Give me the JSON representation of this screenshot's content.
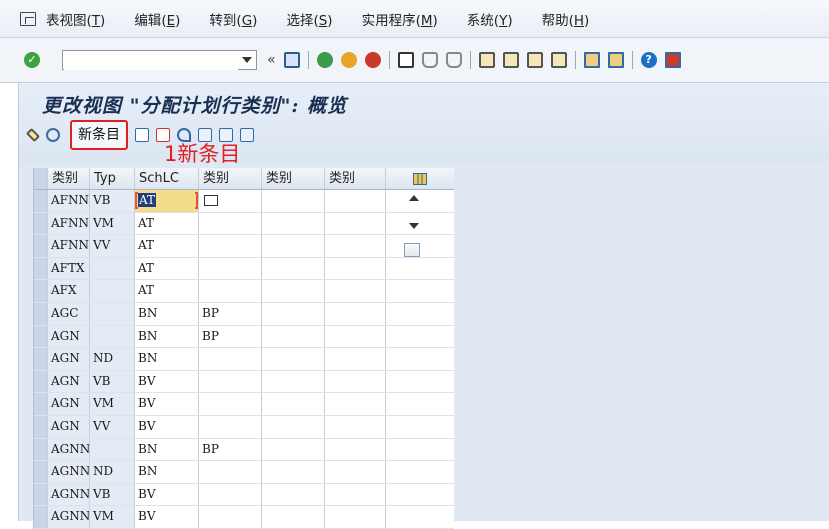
{
  "menu": {
    "items": [
      {
        "label": "表视图",
        "key": "T"
      },
      {
        "label": "编辑",
        "key": "E"
      },
      {
        "label": "转到",
        "key": "G"
      },
      {
        "label": "选择",
        "key": "S"
      },
      {
        "label": "实用程序",
        "key": "M"
      },
      {
        "label": "系统",
        "key": "Y"
      },
      {
        "label": "帮助",
        "key": "H"
      }
    ]
  },
  "toolbar": {
    "command_value": "",
    "double_arrow": "«",
    "ok_glyph": "✓",
    "help_glyph": "?"
  },
  "page": {
    "title": "更改视图 \"分配计划行类别\": 概览",
    "new_entries_label": "新条目",
    "annotation": "1新条目"
  },
  "table": {
    "headers": [
      "类别",
      "Typ",
      "SchLC",
      "类别",
      "类别",
      "类别"
    ],
    "selected_cell_value": "AT",
    "rows": [
      [
        "AFNN",
        "VB",
        "AT",
        "",
        "",
        ""
      ],
      [
        "AFNN",
        "VM",
        "AT",
        "",
        "",
        ""
      ],
      [
        "AFNN",
        "VV",
        "AT",
        "",
        "",
        ""
      ],
      [
        "AFTX",
        "",
        "AT",
        "",
        "",
        ""
      ],
      [
        "AFX",
        "",
        "AT",
        "",
        "",
        ""
      ],
      [
        "AGC",
        "",
        "BN",
        "BP",
        "",
        ""
      ],
      [
        "AGN",
        "",
        "BN",
        "BP",
        "",
        ""
      ],
      [
        "AGN",
        "ND",
        "BN",
        "",
        "",
        ""
      ],
      [
        "AGN",
        "VB",
        "BV",
        "",
        "",
        ""
      ],
      [
        "AGN",
        "VM",
        "BV",
        "",
        "",
        ""
      ],
      [
        "AGN",
        "VV",
        "BV",
        "",
        "",
        ""
      ],
      [
        "AGNN",
        "",
        "BN",
        "BP",
        "",
        ""
      ],
      [
        "AGNN",
        "ND",
        "BN",
        "",
        "",
        ""
      ],
      [
        "AGNN",
        "VB",
        "BV",
        "",
        "",
        ""
      ],
      [
        "AGNN",
        "VM",
        "BV",
        "",
        "",
        ""
      ]
    ]
  },
  "colors": {
    "annotation_red": "#e02020",
    "selection": "#f5dc8c",
    "title": "#1a2f52"
  }
}
